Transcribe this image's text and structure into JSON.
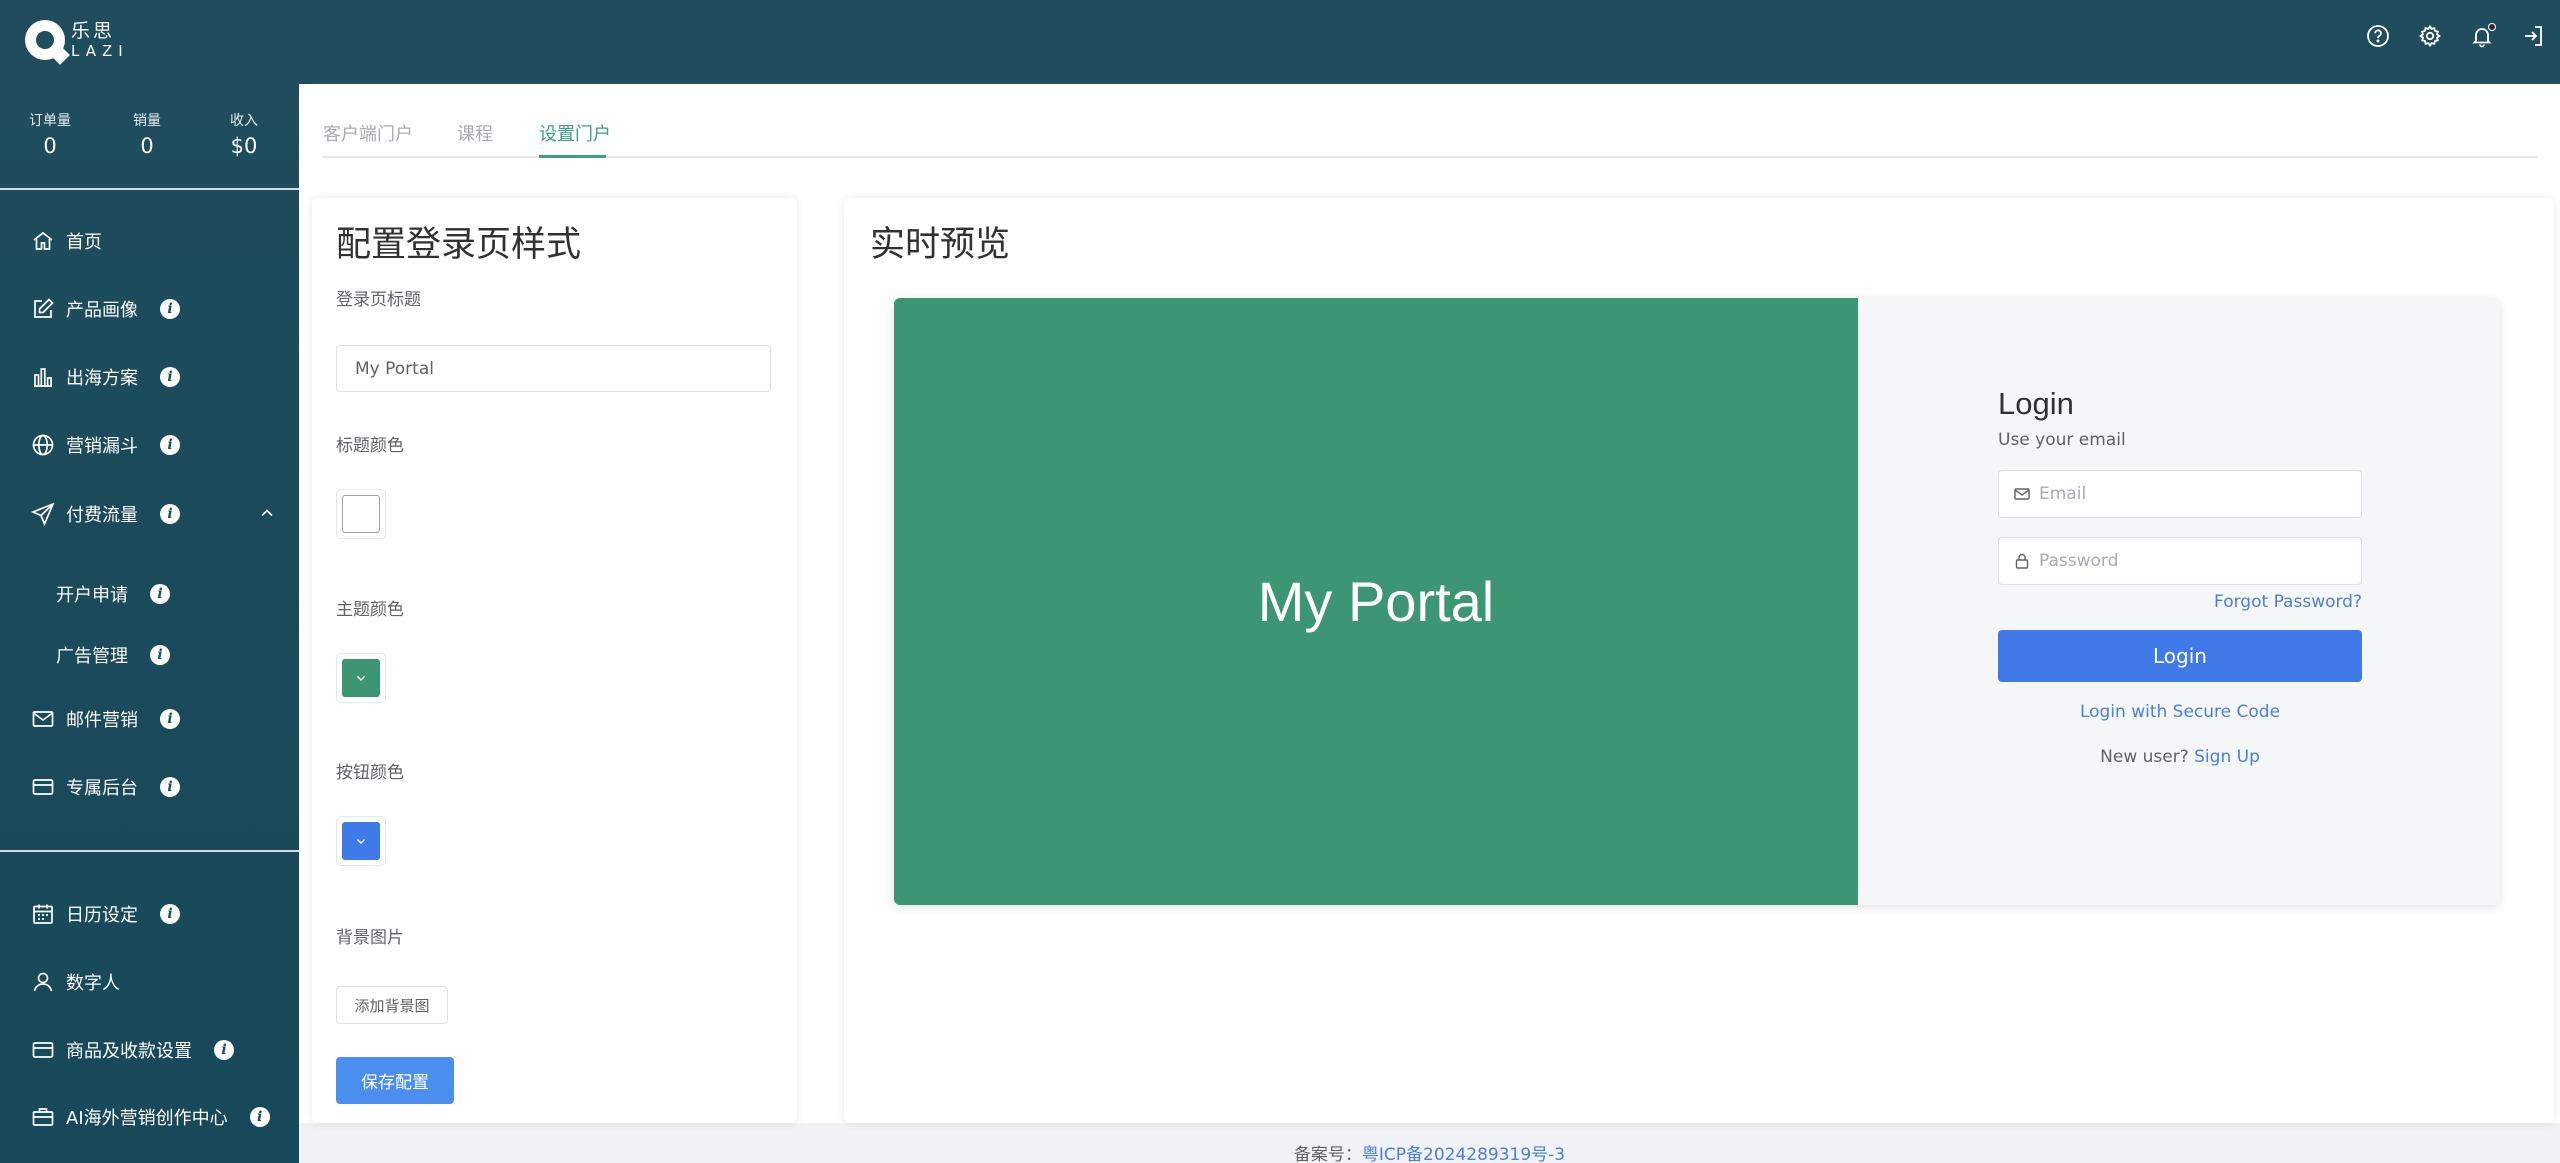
{
  "brand": {
    "name_cn": "乐思",
    "name_en": "LAZI"
  },
  "topbar": {
    "icons": [
      "help-icon",
      "settings-icon",
      "bell-icon",
      "logout-icon"
    ]
  },
  "sidebar": {
    "stats": [
      {
        "label": "订单量",
        "value": "0"
      },
      {
        "label": "销量",
        "value": "0"
      },
      {
        "label": "收入",
        "value": "$0"
      }
    ],
    "items": [
      {
        "label": "首页",
        "icon": "home-icon"
      },
      {
        "label": "产品画像",
        "icon": "edit-icon",
        "info": "i"
      },
      {
        "label": "出海方案",
        "icon": "bar-chart-icon",
        "info": "i"
      },
      {
        "label": "营销漏斗",
        "icon": "globe-icon",
        "info": "i"
      },
      {
        "label": "付费流量",
        "icon": "send-icon",
        "info": "i",
        "expanded": true
      },
      {
        "label": "开户申请",
        "info": "i",
        "sub": true
      },
      {
        "label": "广告管理",
        "info": "i",
        "sub": true
      },
      {
        "label": "邮件营销",
        "icon": "mail-icon",
        "info": "i"
      },
      {
        "label": "专属后台",
        "icon": "card-icon",
        "info": "i"
      }
    ],
    "bottom_items": [
      {
        "label": "日历设定",
        "icon": "calendar-icon",
        "info": "i"
      },
      {
        "label": "数字人",
        "icon": "user-icon"
      },
      {
        "label": "商品及收款设置",
        "icon": "card-icon",
        "info": "i"
      },
      {
        "label": "AI海外营销创作中心",
        "icon": "briefcase-icon",
        "info": "i"
      }
    ]
  },
  "tabs": [
    {
      "label": "客户端门户",
      "active": false
    },
    {
      "label": "课程",
      "active": false
    },
    {
      "label": "设置门户",
      "active": true
    }
  ],
  "config": {
    "title": "配置登录页样式",
    "login_title_label": "登录页标题",
    "login_title_value": "My Portal",
    "title_color_label": "标题颜色",
    "title_color": "#ffffff",
    "theme_color_label": "主题颜色",
    "theme_color": "#3c9674",
    "button_color_label": "按钮颜色",
    "button_color": "#3f7ae8",
    "bg_image_label": "背景图片",
    "add_bg_button": "添加背景图",
    "save_button": "保存配置"
  },
  "preview": {
    "title": "实时预览",
    "hero_title": "My Portal",
    "login_heading": "Login",
    "login_subheading": "Use your email",
    "email_placeholder": "Email",
    "password_placeholder": "Password",
    "forgot_password": "Forgot Password?",
    "login_button": "Login",
    "secure_code_link": "Login with Secure Code",
    "new_user_text": "New user?",
    "sign_up_link": "Sign Up"
  },
  "footer": {
    "label": "备案号：",
    "icp": "粤ICP备2024289319号-3"
  },
  "colors": {
    "header_bg": "#1f4d5e",
    "accent_teal": "#3b9f8c",
    "link_blue": "#4a7fe0",
    "save_blue": "#4a8ef0"
  }
}
